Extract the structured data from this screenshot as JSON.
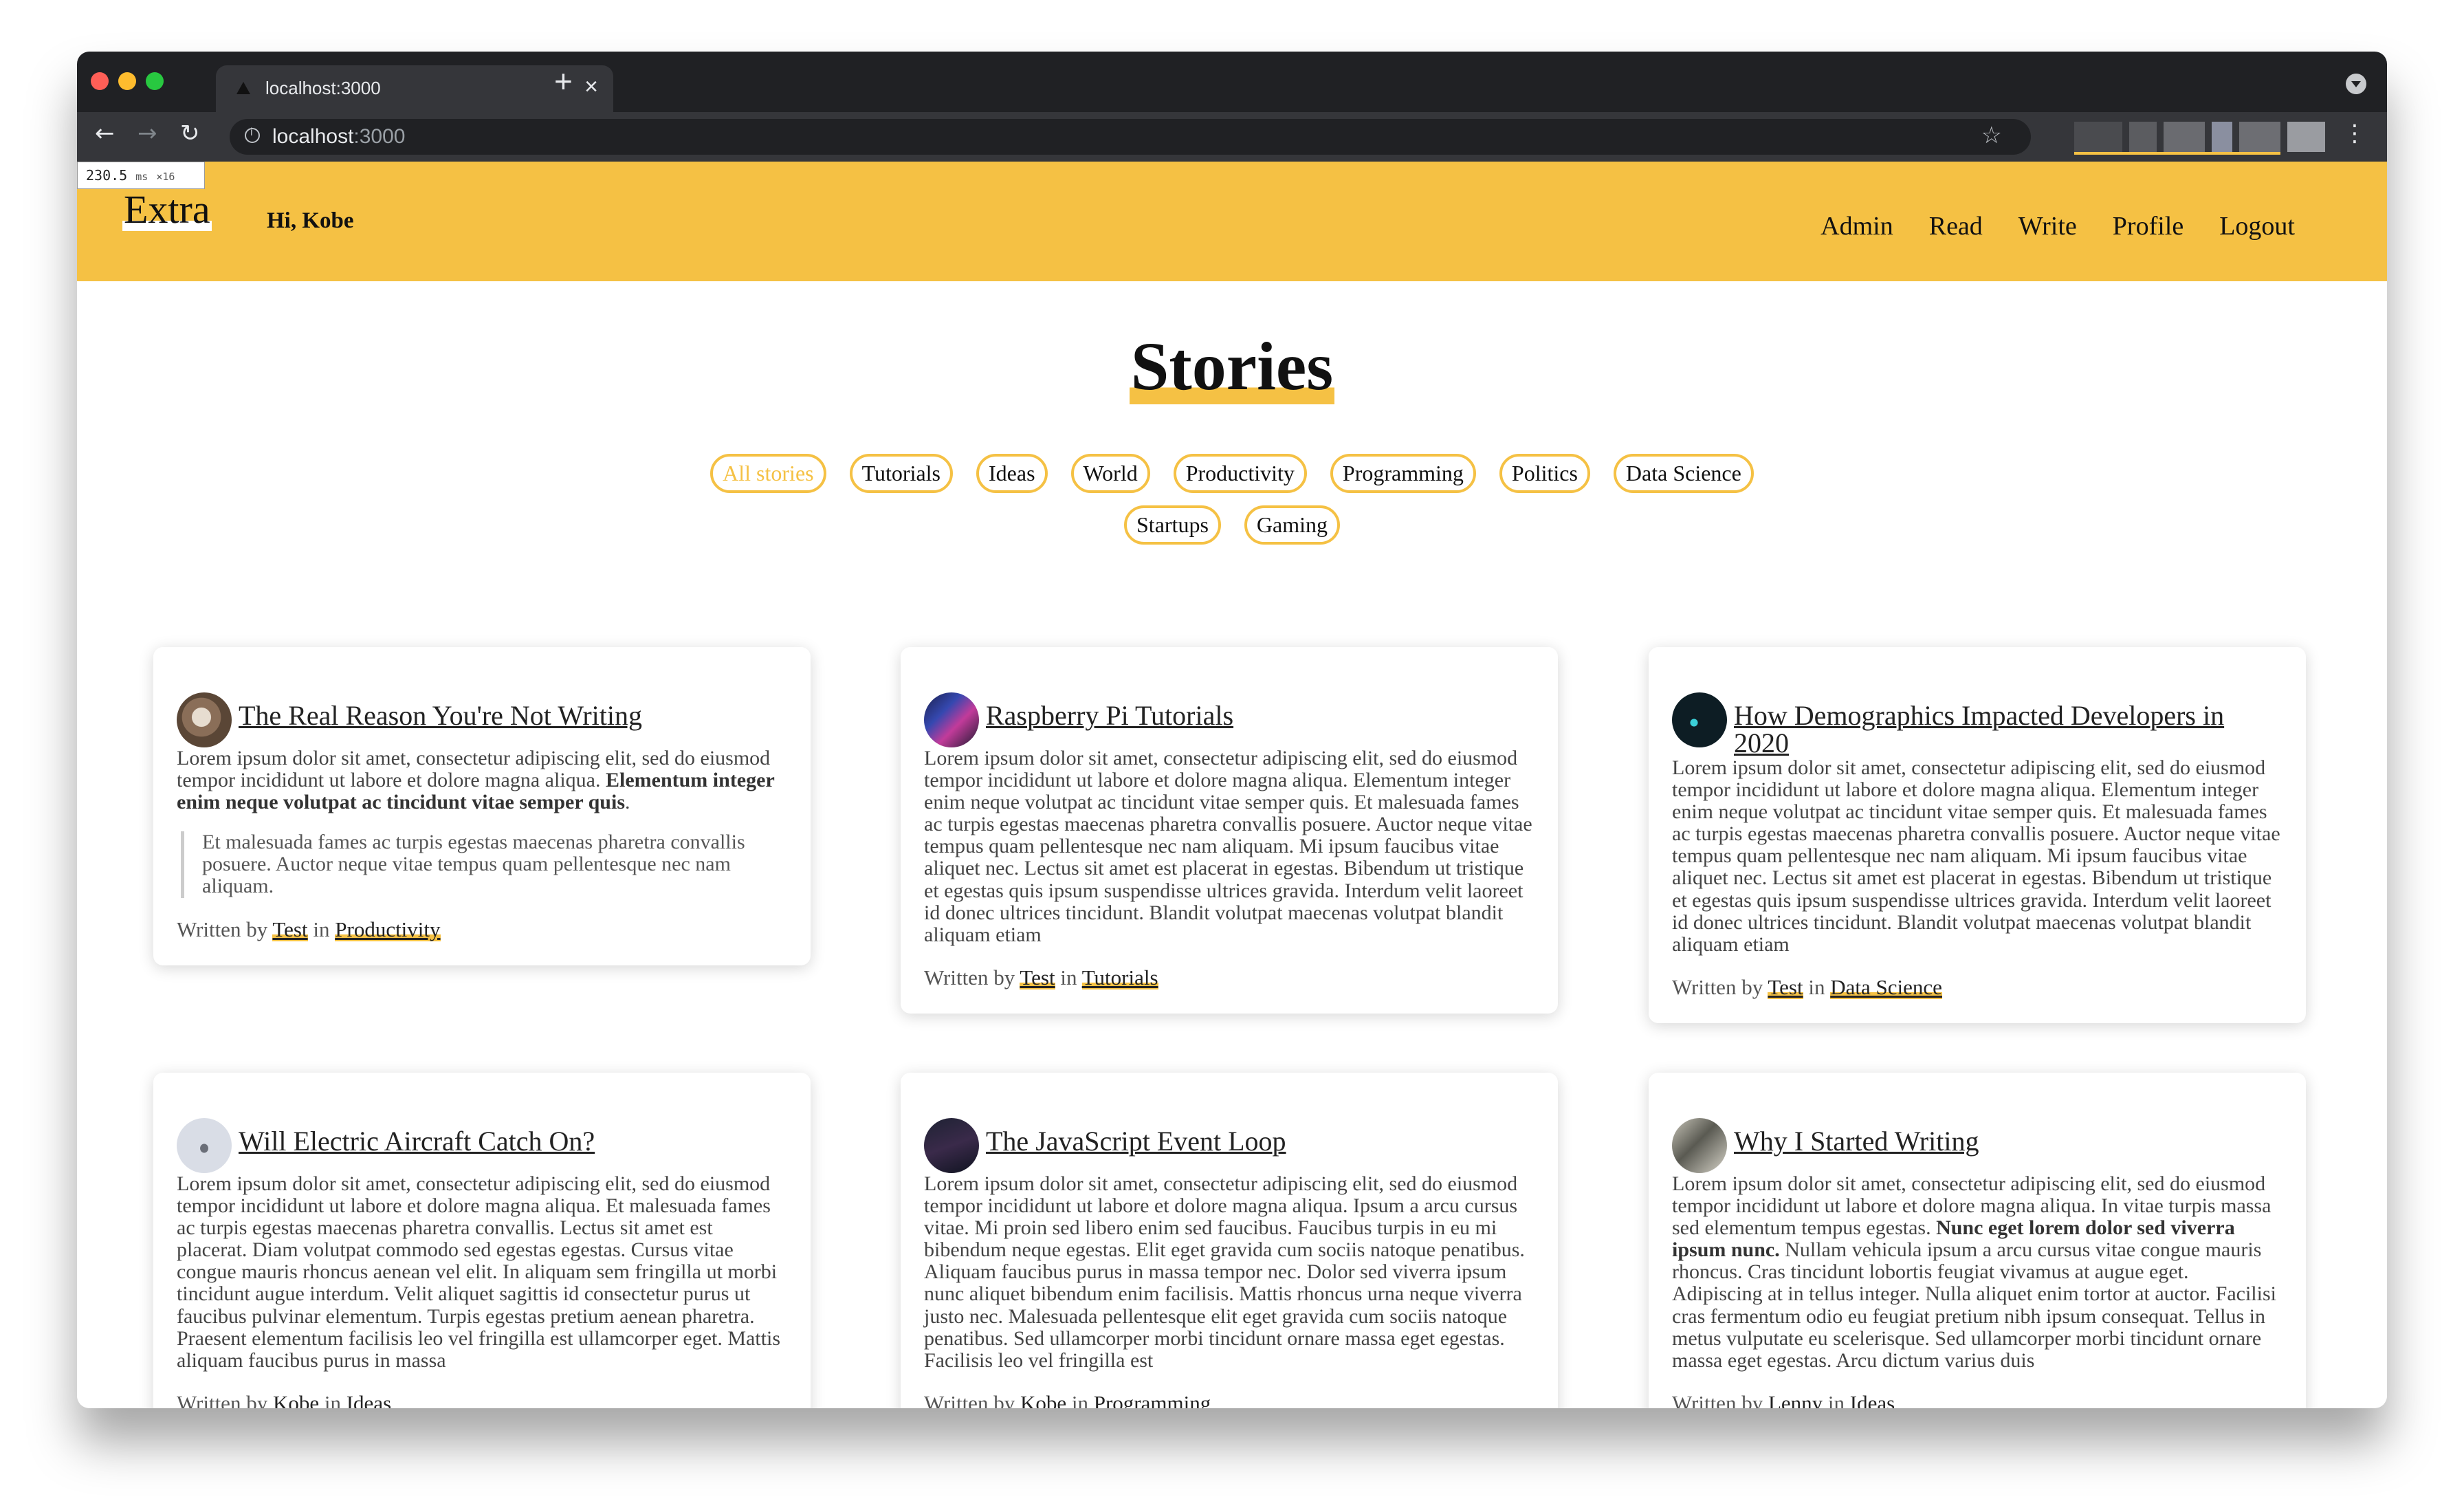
{
  "browser": {
    "tab_title": "localhost:3000",
    "tab_close": "×",
    "new_tab": "+",
    "url_host": "localhost",
    "url_port": ":3000",
    "back_icon": "←",
    "forward_icon": "→",
    "reload_icon": "↻",
    "star_icon": "☆",
    "menu_icon": "⋮",
    "traffic_colors": [
      "#ff5f57",
      "#febc2e",
      "#28c840"
    ]
  },
  "perf_badge": {
    "value": "230.5",
    "unit": "ms",
    "multiplier": "×16"
  },
  "header": {
    "logo": "Extra",
    "greeting": "Hi, Kobe",
    "nav": [
      "Admin",
      "Read",
      "Write",
      "Profile",
      "Logout"
    ],
    "accent": "#f5c144"
  },
  "page": {
    "title": "Stories",
    "filters_row1": [
      "All stories",
      "Tutorials",
      "Ideas",
      "World",
      "Productivity",
      "Programming",
      "Politics",
      "Data Science"
    ],
    "filters_row2": [
      "Startups",
      "Gaming"
    ]
  },
  "byline_words": {
    "written_by": "Written by",
    "in": "in"
  },
  "cards": [
    {
      "title": "The Real Reason You're Not Writing",
      "body": "Lorem ipsum dolor sit amet, consectetur adipiscing elit, sed do eiusmod tempor incididunt ut labore et dolore magna aliqua.",
      "body_bold": "Elementum integer enim neque volutpat ac tincidunt vitae semper quis",
      "body_after": ".",
      "quote": "Et malesuada fames ac turpis egestas maecenas pharetra convallis posuere. Auctor neque vitae tempus quam pellentesque nec nam aliquam.",
      "author": "Test",
      "category": "Productivity"
    },
    {
      "title": "Raspberry Pi Tutorials",
      "body": "Lorem ipsum dolor sit amet, consectetur adipiscing elit, sed do eiusmod tempor incididunt ut labore et dolore magna aliqua. Elementum integer enim neque volutpat ac tincidunt vitae semper quis. Et malesuada fames ac turpis egestas maecenas pharetra convallis posuere. Auctor neque vitae tempus quam pellentesque nec nam aliquam. Mi ipsum faucibus vitae aliquet nec. Lectus sit amet est placerat in egestas. Bibendum ut tristique et egestas quis ipsum suspendisse ultrices gravida. Interdum velit laoreet id donec ultrices tincidunt. Blandit volutpat maecenas volutpat blandit aliquam etiam",
      "author": "Test",
      "category": "Tutorials"
    },
    {
      "title": "How Demographics Impacted Developers in 2020",
      "body": "Lorem ipsum dolor sit amet, consectetur adipiscing elit, sed do eiusmod tempor incididunt ut labore et dolore magna aliqua. Elementum integer enim neque volutpat ac tincidunt vitae semper quis. Et malesuada fames ac turpis egestas maecenas pharetra convallis posuere. Auctor neque vitae tempus quam pellentesque nec nam aliquam. Mi ipsum faucibus vitae aliquet nec. Lectus sit amet est placerat in egestas. Bibendum ut tristique et egestas quis ipsum suspendisse ultrices gravida. Interdum velit laoreet id donec ultrices tincidunt. Blandit volutpat maecenas volutpat blandit aliquam etiam",
      "author": "Test",
      "category": "Data Science"
    },
    {
      "title": "Will Electric Aircraft Catch On?",
      "body": "Lorem ipsum dolor sit amet, consectetur adipiscing elit, sed do eiusmod tempor incididunt ut labore et dolore magna aliqua. Et malesuada fames ac turpis egestas maecenas pharetra convallis. Lectus sit amet est placerat. Diam volutpat commodo sed egestas egestas. Cursus vitae congue mauris rhoncus aenean vel elit. In aliquam sem fringilla ut morbi tincidunt augue interdum. Velit aliquet sagittis id consectetur purus ut faucibus pulvinar elementum. Turpis egestas pretium aenean pharetra. Praesent elementum facilisis leo vel fringilla est ullamcorper eget. Mattis aliquam faucibus purus in massa",
      "author": "Kobe",
      "category": "Ideas"
    },
    {
      "title": "The JavaScript Event Loop",
      "body": "Lorem ipsum dolor sit amet, consectetur adipiscing elit, sed do eiusmod tempor incididunt ut labore et dolore magna aliqua. Ipsum a arcu cursus vitae. Mi proin sed libero enim sed faucibus. Faucibus turpis in eu mi bibendum neque egestas. Elit eget gravida cum sociis natoque penatibus. Aliquam faucibus purus in massa tempor nec. Dolor sed viverra ipsum nunc aliquet bibendum enim facilisis. Mattis rhoncus urna neque viverra justo nec. Malesuada pellentesque elit eget gravida cum sociis natoque penatibus. Sed ullamcorper morbi tincidunt ornare massa eget egestas. Facilisis leo vel fringilla est",
      "author": "Kobe",
      "category": "Programming"
    },
    {
      "title": "Why I Started Writing",
      "body": "Lorem ipsum dolor sit amet, consectetur adipiscing elit, sed do eiusmod tempor incididunt ut labore et dolore magna aliqua. In vitae turpis massa sed elementum tempus egestas.",
      "body_bold": "Nunc eget lorem dolor sed viverra ipsum nunc.",
      "body_after": "Nullam vehicula ipsum a arcu cursus vitae congue mauris rhoncus. Cras tincidunt lobortis feugiat vivamus at augue eget. Adipiscing at in tellus integer. Nulla aliquet enim tortor at auctor. Facilisi cras fermentum odio eu feugiat pretium nibh ipsum consequat. Tellus in metus vulputate eu scelerisque. Sed ullamcorper morbi tincidunt ornare massa eget egestas. Arcu dictum varius duis",
      "author": "Lenny",
      "category": "Ideas"
    }
  ]
}
